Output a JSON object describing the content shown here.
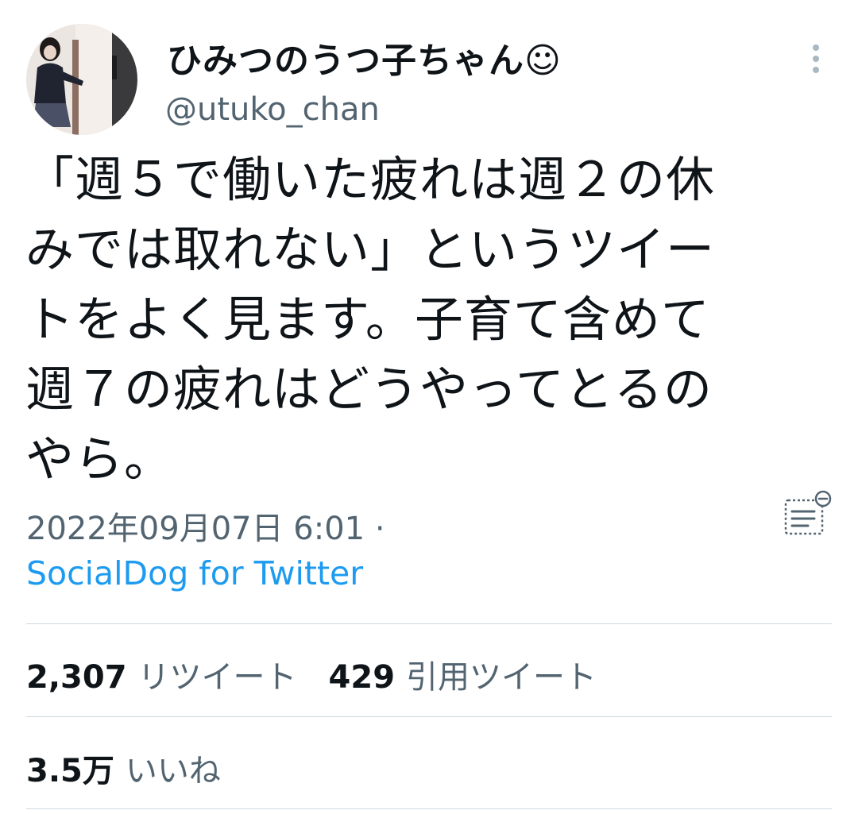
{
  "user": {
    "display_name": "ひみつのうつ子ちゃん☺",
    "handle": "@utuko_chan"
  },
  "tweet": {
    "text": "「週５で働いた疲れは週２の休\nみでは取れない」というツイー\nトをよく見ます。子育て含めて\n週７の疲れはどうやってとるの\nやら。",
    "timestamp": "2022年09月07日 6:01",
    "separator": "·",
    "source": "SocialDog for Twitter"
  },
  "stats": {
    "retweets_count": "2,307",
    "retweets_label": "リツイート",
    "quotes_count": "429",
    "quotes_label": "引用ツイート",
    "likes_count": "3.5万",
    "likes_label": "いいね"
  },
  "icons": {
    "more": "more-vertical-icon",
    "notes": "notes-icon"
  },
  "colors": {
    "text": "#0f1419",
    "secondary": "#536471",
    "link": "#1d9bf0",
    "divider": "#cfd9de"
  }
}
